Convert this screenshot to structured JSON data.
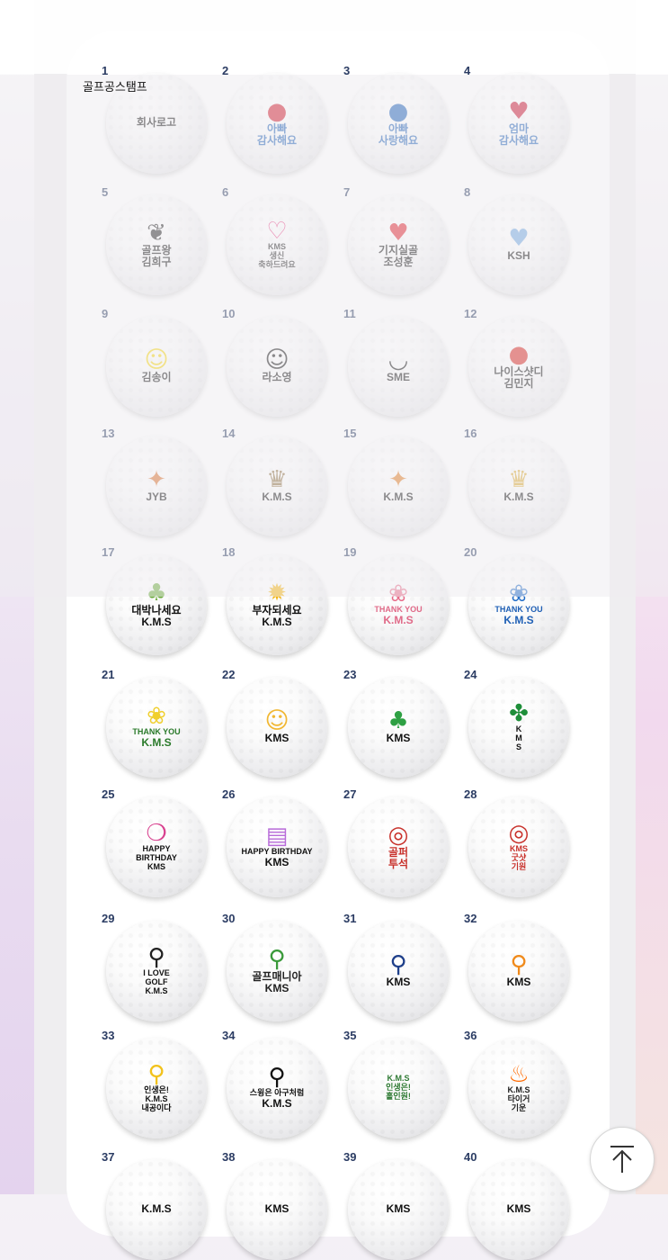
{
  "page": {
    "title": "골프공스탬프"
  },
  "colors": {
    "number_color": "#2b3c63",
    "card_bg": "#ffffff"
  },
  "scroll_top_button": {
    "icon": "arrow-up-to-top-icon"
  },
  "balls": [
    {
      "number": "1",
      "lines": [
        "회사로고"
      ],
      "icon": ""
    },
    {
      "number": "2",
      "lines": [
        "아빠",
        "감사해요"
      ],
      "icon": "red-rose-icon"
    },
    {
      "number": "3",
      "lines": [
        "아빠",
        "사랑해요"
      ],
      "icon": "blue-rose-icon"
    },
    {
      "number": "4",
      "lines": [
        "엄마",
        "감사해요"
      ],
      "icon": "red-heart-rose-icon"
    },
    {
      "number": "5",
      "lines": [
        "골프왕",
        "김희구"
      ],
      "icon": "laurel-wreath-icon"
    },
    {
      "number": "6",
      "lines": [
        "KMS",
        "생신",
        "축하드려요"
      ],
      "icon": "pink-heart-icon"
    },
    {
      "number": "7",
      "lines": [
        "기지실골",
        "조성훈"
      ],
      "icon": "heart-sunglasses-icon"
    },
    {
      "number": "8",
      "lines": [
        "KSH"
      ],
      "icon": "blue-smiling-heart-icon"
    },
    {
      "number": "9",
      "lines": [
        "김송이"
      ],
      "icon": "yellow-smiley-icon"
    },
    {
      "number": "10",
      "lines": [
        "라소영"
      ],
      "icon": "outline-smiley-icon"
    },
    {
      "number": "11",
      "lines": [
        "SME"
      ],
      "icon": "smile-face-icon"
    },
    {
      "number": "12",
      "lines": [
        "나이스샷디",
        "김민지"
      ],
      "icon": "red-apple-icon"
    },
    {
      "number": "13",
      "lines": [
        "JYB"
      ],
      "icon": "colorful-tiger-icon"
    },
    {
      "number": "14",
      "lines": [
        "K.M.S"
      ],
      "icon": "crowned-tiger-icon"
    },
    {
      "number": "15",
      "lines": [
        "K.M.S"
      ],
      "icon": "tiger-face-icon"
    },
    {
      "number": "16",
      "lines": [
        "K.M.S"
      ],
      "icon": "gold-crown-ball-icon"
    },
    {
      "number": "17",
      "lines": [
        "대박나세요",
        "K.M.S"
      ],
      "icon": "money-tree-icon"
    },
    {
      "number": "18",
      "lines": [
        "부자되세요",
        "K.M.S"
      ],
      "icon": "sunflower-icon"
    },
    {
      "number": "19",
      "lines": [
        "THANK YOU",
        "K.M.S"
      ],
      "icon": "pink-rose-icon"
    },
    {
      "number": "20",
      "lines": [
        "THANK YOU",
        "K.M.S"
      ],
      "icon": "blue-flower-icon"
    },
    {
      "number": "21",
      "lines": [
        "THANK YOU",
        "K.M.S"
      ],
      "icon": "yellow-roses-icon"
    },
    {
      "number": "22",
      "lines": [
        "KMS"
      ],
      "icon": "clover-golfer-icon"
    },
    {
      "number": "23",
      "lines": [
        "KMS"
      ],
      "icon": "green-clover-icon"
    },
    {
      "number": "24",
      "lines": [
        "K",
        "M",
        "S"
      ],
      "icon": "four-leaf-clover-icon"
    },
    {
      "number": "25",
      "lines": [
        "HAPPY",
        "BIRTHDAY",
        "KMS"
      ],
      "icon": "balloons-icon"
    },
    {
      "number": "26",
      "lines": [
        "HAPPY BIRTHDAY",
        "KMS"
      ],
      "icon": "birthday-cake-icon"
    },
    {
      "number": "27",
      "lines": [
        "골퍼",
        "투석"
      ],
      "icon": "red-seal-icon"
    },
    {
      "number": "28",
      "lines": [
        "KMS",
        "굿샷",
        "기원"
      ],
      "icon": "red-seal-icon"
    },
    {
      "number": "29",
      "lines": [
        "I LOVE",
        "GOLF",
        "K.M.S"
      ],
      "icon": "woman-golfer-icon"
    },
    {
      "number": "30",
      "lines": [
        "골프매니아",
        "KMS"
      ],
      "icon": "green-golfer-icon"
    },
    {
      "number": "31",
      "lines": [
        "KMS"
      ],
      "icon": "blue-golfer-icon"
    },
    {
      "number": "32",
      "lines": [
        "KMS"
      ],
      "icon": "orange-golfer-icon"
    },
    {
      "number": "33",
      "lines": [
        "인생은!",
        "K.M.S",
        "내공이다"
      ],
      "icon": "yellow-golfer-icon"
    },
    {
      "number": "34",
      "lines": [
        "스윙은 아구처럼",
        "K.M.S"
      ],
      "icon": "black-golfer-icon"
    },
    {
      "number": "35",
      "lines": [
        "K.M.S",
        "인생은!",
        "홀인원!"
      ],
      "icon": ""
    },
    {
      "number": "36",
      "lines": [
        "K.M.S",
        "타이거",
        "기운"
      ],
      "icon": "fire-icon"
    },
    {
      "number": "37",
      "lines": [
        "K.M.S"
      ],
      "icon": ""
    },
    {
      "number": "38",
      "lines": [
        "KMS"
      ],
      "icon": ""
    },
    {
      "number": "39",
      "lines": [
        "KMS"
      ],
      "icon": ""
    },
    {
      "number": "40",
      "lines": [
        "KMS"
      ],
      "icon": ""
    }
  ]
}
